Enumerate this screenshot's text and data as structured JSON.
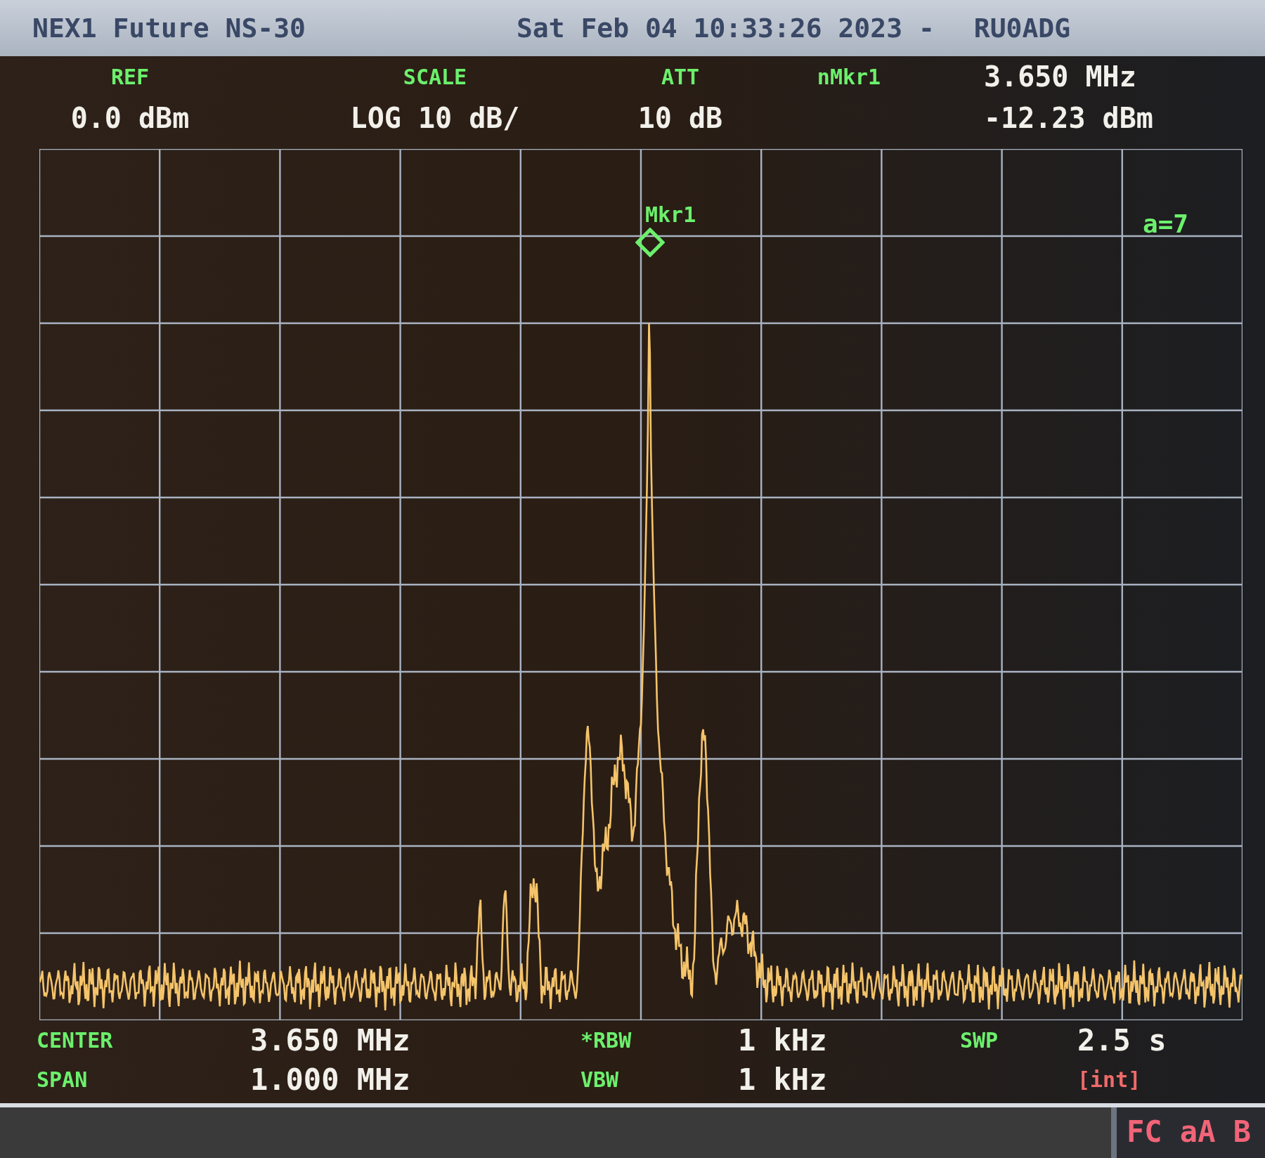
{
  "header": {
    "model": "NEX1 Future NS-30",
    "timestamp": "Sat Feb 04 10:33:26 2023 -",
    "callsign": "RU0ADG"
  },
  "top_readouts": [
    {
      "label": "REF",
      "value": "0.0 dBm"
    },
    {
      "label": "SCALE",
      "value": "LOG 10 dB/"
    },
    {
      "label": "ATT",
      "value": "10 dB"
    }
  ],
  "marker_readout": {
    "label": "nMkr1",
    "frequency": "3.650 MHz",
    "amplitude": "-12.23 dBm"
  },
  "display": {
    "marker_label": "Mkr1",
    "averaging": "a=7"
  },
  "bottom_readouts": [
    {
      "label": "CENTER",
      "value": "3.650 MHz"
    },
    {
      "label": "*RBW",
      "value": "1 kHz"
    },
    {
      "label": "SWP",
      "value": "2.5 s"
    },
    {
      "label": "SPAN",
      "value": "1.000 MHz"
    },
    {
      "label": "VBW",
      "value": "1 kHz"
    }
  ],
  "sweep_note": "[int]",
  "status_bar": {
    "indicators": "FC aA B"
  }
}
